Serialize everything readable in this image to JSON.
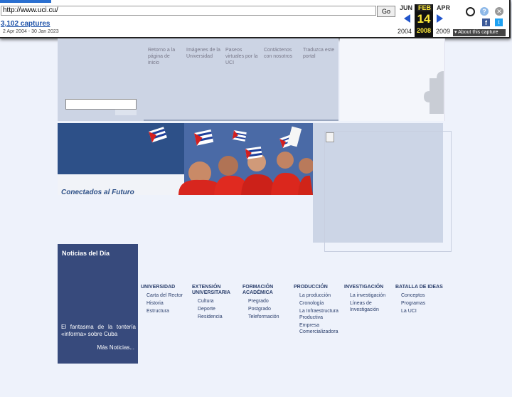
{
  "wayback": {
    "url": "http://www.uci.cu/",
    "go_label": "Go",
    "captures_label": "3,102 captures",
    "date_range": "2 Apr 2004 - 30 Jan 2023",
    "prev_month": "JUN",
    "current_month": "FEB",
    "next_month": "APR",
    "day": "14",
    "prev_year": "2004",
    "current_year": "2008",
    "next_year": "2009",
    "about_label": "About this capture",
    "icons": [
      "user-icon",
      "help-icon",
      "close-icon",
      "facebook-icon",
      "twitter-icon"
    ]
  },
  "header": {
    "nav": [
      {
        "label": "Retorno a la página de inicio"
      },
      {
        "label": "Imágenes de la Universidad"
      },
      {
        "label": "Paseos virtuales por la UCI"
      },
      {
        "label": "Contáctenos con nosotros"
      },
      {
        "label": "Traduzca este portal"
      }
    ]
  },
  "banner": {
    "caption": "Conectados al Futuro"
  },
  "news": {
    "title": "Noticias del Día",
    "item": "El fantasma de la tontería «informa» sobre Cuba",
    "more": "Más Noticias..."
  },
  "columns": [
    {
      "title": "UNIVERSIDAD",
      "links": [
        "Carta del Rector",
        "Historia",
        "Estructura"
      ]
    },
    {
      "title": "EXTENSIÓN UNIVERSITARIA",
      "links": [
        "Cultura",
        "Deporte",
        "Residencia"
      ]
    },
    {
      "title": "FORMACIÓN ACADÉMICA",
      "links": [
        "Pregrado",
        "Postgrado",
        "Teleformación"
      ]
    },
    {
      "title": "PRODUCCIÓN",
      "links": [
        "La producción",
        "Cronología",
        "La Infraestructura Productiva",
        "Empresa Comercializadora"
      ]
    },
    {
      "title": "INVESTIGACIÓN",
      "links": [
        "La investigación",
        "Líneas de Investigación"
      ]
    },
    {
      "title": "BATALLA DE IDEAS",
      "links": [
        "Conceptos",
        "Programas",
        "La UCI"
      ]
    }
  ],
  "colors": {
    "news_bg": "#374a7c",
    "banner_blue": "#2d5088",
    "header_bg": "#ccd4e4"
  }
}
